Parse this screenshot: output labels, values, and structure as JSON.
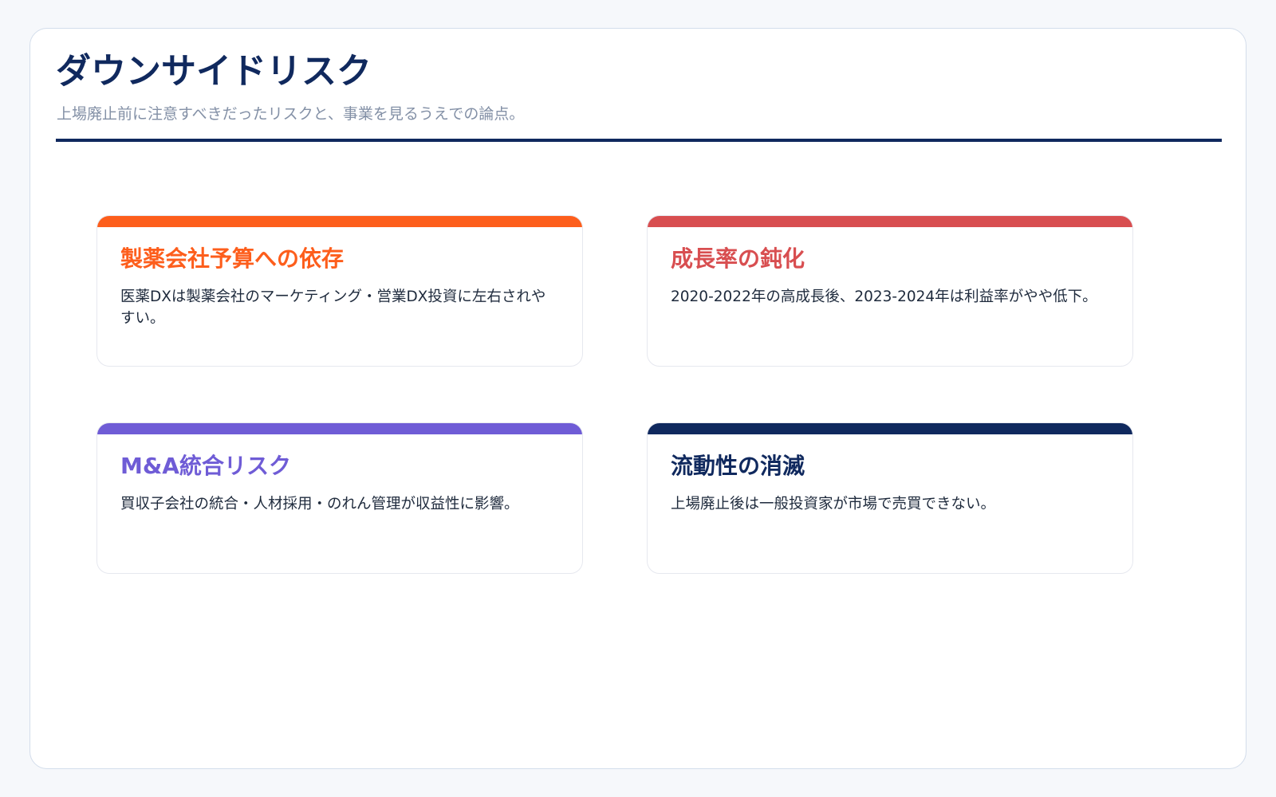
{
  "header": {
    "title": "ダウンサイドリスク",
    "subtitle": "上場廃止前に注意すべきだったリスクと、事業を見るうえでの論点。"
  },
  "colors": {
    "title": "#10295e",
    "subtitle": "#8390a6",
    "rule": "#10295e"
  },
  "cards": [
    {
      "title": "製薬会社予算への依存",
      "description": "医薬DXは製薬会社のマーケティング・営業DX投資に左右されやすい。",
      "accent": "#fd5e1c"
    },
    {
      "title": "成長率の鈍化",
      "description": "2020-2022年の高成長後、2023-2024年は利益率がやや低下。",
      "accent": "#d84e50"
    },
    {
      "title": "M&A統合リスク",
      "description": "買収子会社の統合・人材採用・のれん管理が収益性に影響。",
      "accent": "#6f5cd6"
    },
    {
      "title": "流動性の消滅",
      "description": "上場廃止後は一般投資家が市場で売買できない。",
      "accent": "#10295e"
    }
  ]
}
